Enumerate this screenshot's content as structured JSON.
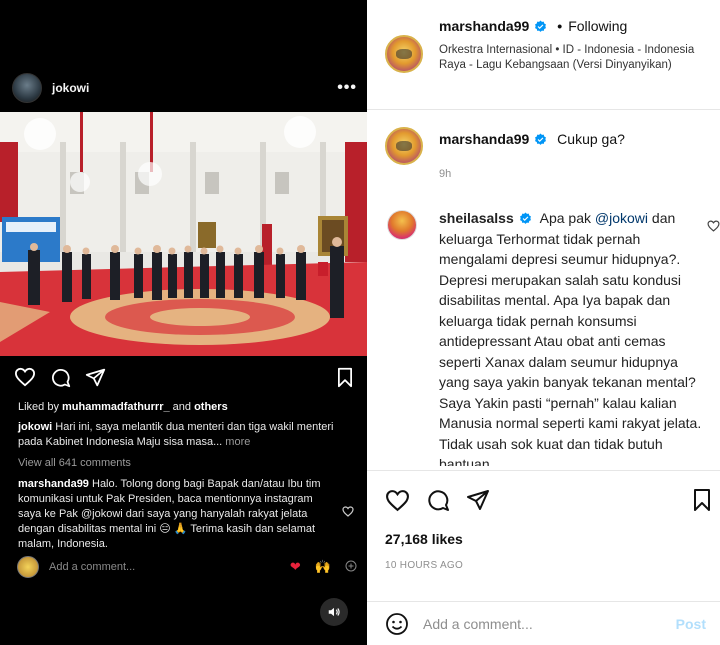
{
  "left_panel": {
    "username": "jokowi",
    "more_label": "•••",
    "likes": {
      "prefix": "Liked by ",
      "user": "muhammadfathurrr_",
      "joiner": " and ",
      "others": "others"
    },
    "caption": {
      "user": "jokowi",
      "text": " Hari ini, saya melantik dua menteri dan tiga wakil menteri pada Kabinet Indonesia Maju sisa masa... ",
      "more": "more"
    },
    "view_all": "View all 641 comments",
    "comment": {
      "user": "marshanda99",
      "text": " Halo. Tolong dong bagi Bapak dan/atau Ibu tim komunikasi untuk Pak Presiden, baca mentionnya instagram saya ke Pak @jokowi dari saya yang hanyalah rakyat jelata dengan disabilitas mental ini 😑 🙏 Terima kasih dan selamat malam, Indonesia."
    },
    "add_comment_placeholder": "Add a comment...",
    "emoji_red_heart": "❤",
    "emoji_raised_hands": "🙌"
  },
  "right_panel": {
    "header": {
      "username": "marshanda99",
      "dot": "•",
      "follow_status": "Following",
      "music_text": "Orkestra Internasional • ID - Indonesia - Indonesia Raya - Lagu Kebangsaan (Versi Dinyanyikan)"
    },
    "first_comment": {
      "username": "marshanda99",
      "text": "Cukup ga?",
      "time": "9h"
    },
    "second_comment": {
      "username": "sheilasalss",
      "text_before_mention": "Apa pak ",
      "mention": "@jokowi",
      "text_after_mention": " dan keluarga Terhormat tidak pernah mengalami depresi seumur hidupnya?. Depresi merupakan salah satu kondusi disabilitas mental. Apa Iya bapak dan keluarga tidak pernah konsumsi antidepressant Atau obat anti cemas seperti Xanax dalam seumur hidupnya yang saya yakin banyak tekanan mental? Saya Yakin pasti “pernah” kalau kalian Manusia normal seperti kami rakyat jelata. Tidak usah sok kuat dan tidak butuh bantuan."
    },
    "likes_count": "27,168 likes",
    "time_ago": "10 HOURS AGO",
    "add_comment_placeholder": "Add a comment...",
    "post_label": "Post"
  },
  "colors": {
    "left_background": "#000000",
    "verified_blue": "#0095f6",
    "post_disabled": "#b2dffc",
    "mention": "#00376b"
  },
  "icons": [
    "heart-icon",
    "comment-icon",
    "share-icon",
    "bookmark-icon",
    "emoji-icon",
    "verified-icon",
    "sound-icon",
    "more-icon"
  ]
}
